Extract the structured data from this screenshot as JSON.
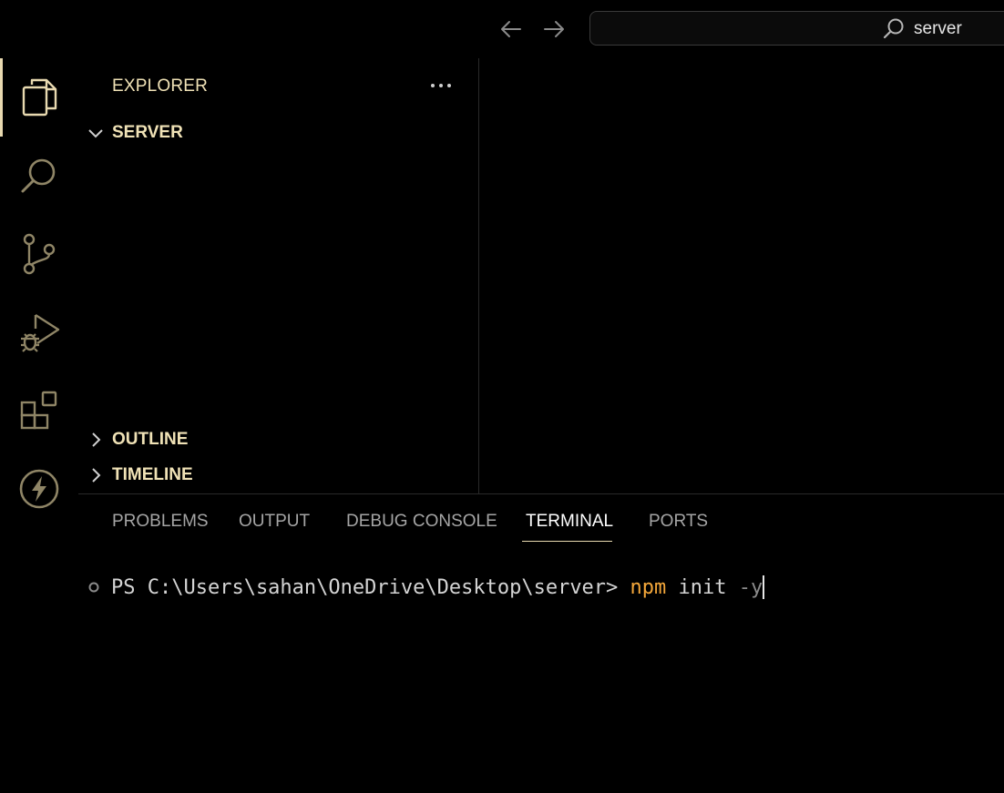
{
  "titlebar": {
    "search_text": "server"
  },
  "sidebar": {
    "title": "EXPLORER",
    "sections": [
      {
        "label": "SERVER",
        "expanded": true
      },
      {
        "label": "OUTLINE",
        "expanded": false
      },
      {
        "label": "TIMELINE",
        "expanded": false
      }
    ]
  },
  "activity_bar": {
    "items": [
      "files-icon",
      "search-icon",
      "source-control-icon",
      "run-debug-icon",
      "extensions-icon",
      "thunder-icon"
    ],
    "active": "files-icon"
  },
  "panel": {
    "tabs": [
      {
        "label": "PROBLEMS"
      },
      {
        "label": "OUTPUT"
      },
      {
        "label": "DEBUG CONSOLE"
      },
      {
        "label": "TERMINAL"
      },
      {
        "label": "PORTS"
      }
    ],
    "active_tab": "TERMINAL"
  },
  "terminal": {
    "prompt": "PS C:\\Users\\sahan\\OneDrive\\Desktop\\server> ",
    "command": "npm",
    "args": " init ",
    "flag": "-y"
  },
  "colors": {
    "background": "#000000",
    "accent": "#e8d9b0",
    "heading": "#f0e2b6",
    "icon": "#8f8566",
    "command": "#f4a73a"
  }
}
